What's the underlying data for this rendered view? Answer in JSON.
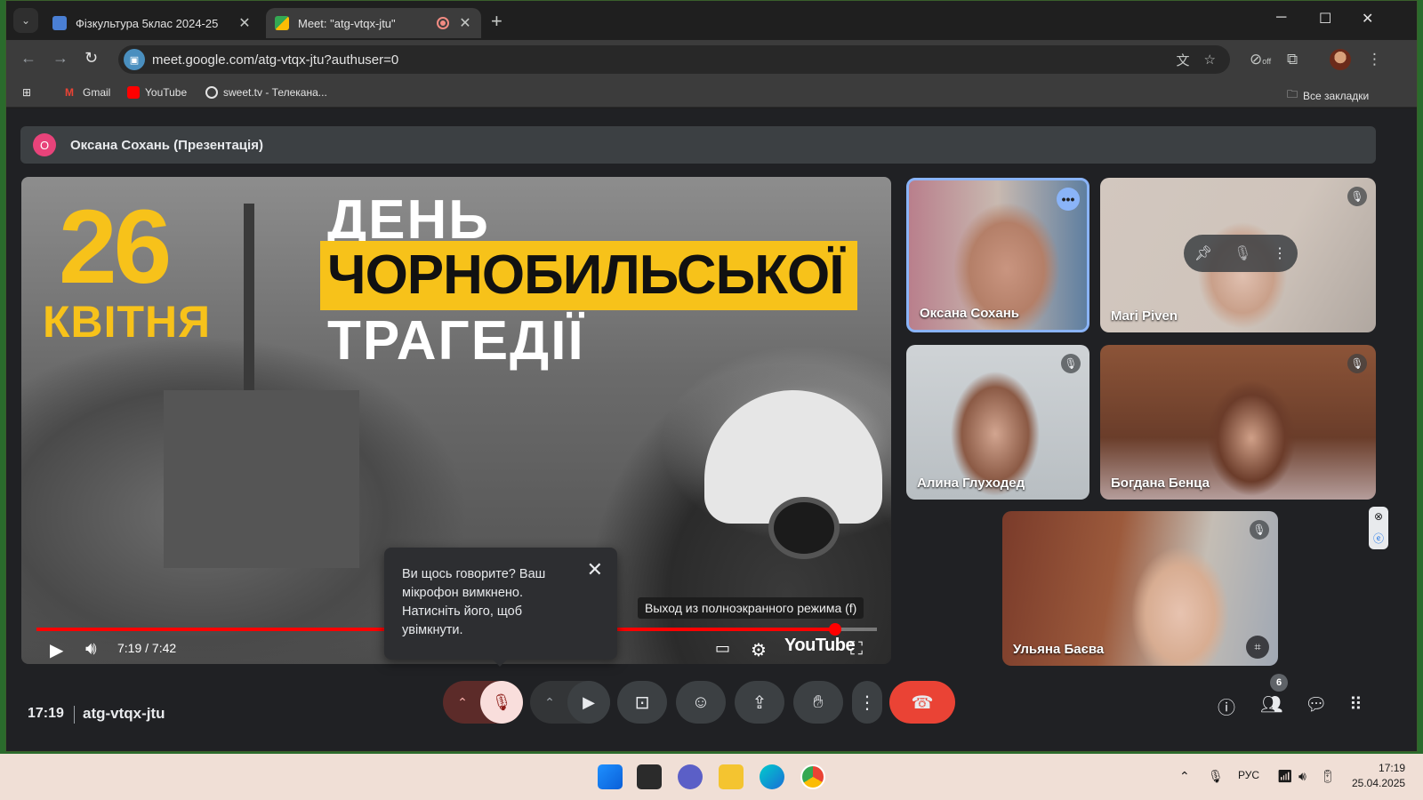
{
  "browser": {
    "tabs": [
      {
        "title": "Фізкультура 5клас 2024-25",
        "favicon_color": "#4a7fd4"
      },
      {
        "title": "Meet: \"atg-vtqx-jtu\"",
        "favicon_color": "#34a853",
        "recording": true
      }
    ],
    "url": "meet.google.com/atg-vtqx-jtu?authuser=0",
    "bookmarks": [
      {
        "label": "Gmail",
        "icon": "gmail-icon"
      },
      {
        "label": "YouTube",
        "icon": "youtube-icon"
      },
      {
        "label": "sweet.tv - Телекана...",
        "icon": "sweettv-icon"
      }
    ],
    "all_bookmarks": "Все закладки",
    "extension_badge": "off"
  },
  "meet": {
    "presenter_initial": "О",
    "presenter_banner": "Оксана Сохань (Презентація)",
    "video": {
      "date_number": "26",
      "date_month": "КВІТНЯ",
      "headline_1": "ДЕНЬ",
      "headline_2": "ЧОРНОБИЛЬСЬКОЇ",
      "headline_3": "ТРАГЕДІЇ",
      "timecode": "7:19 / 7:42",
      "progress": 0.95,
      "fullscreen_tooltip": "Выход из полноэкранного режима (f)",
      "youtube_label": "YouTube"
    },
    "participants": [
      {
        "name": "Оксана Сохань",
        "speaking": true
      },
      {
        "name": "Mari Piven",
        "muted": true
      },
      {
        "name": "Алина Глуходед",
        "muted": true
      },
      {
        "name": "Богдана Бенца",
        "muted": true
      },
      {
        "name": "Ульяна Баєва",
        "muted": true
      }
    ],
    "mic_popup": "Ви щось говорите? Ваш мікрофон вимкнено. Натисніть його, щоб увімкнути.",
    "clock": "17:19",
    "meeting_code": "atg-vtqx-jtu",
    "people_count": "6",
    "colors": {
      "accent": "#8ab4f8",
      "hangup": "#ea4335",
      "mic_off_bg": "#f9dedc"
    }
  },
  "taskbar": {
    "language": "РУС",
    "time": "17:19",
    "date": "25.04.2025"
  }
}
